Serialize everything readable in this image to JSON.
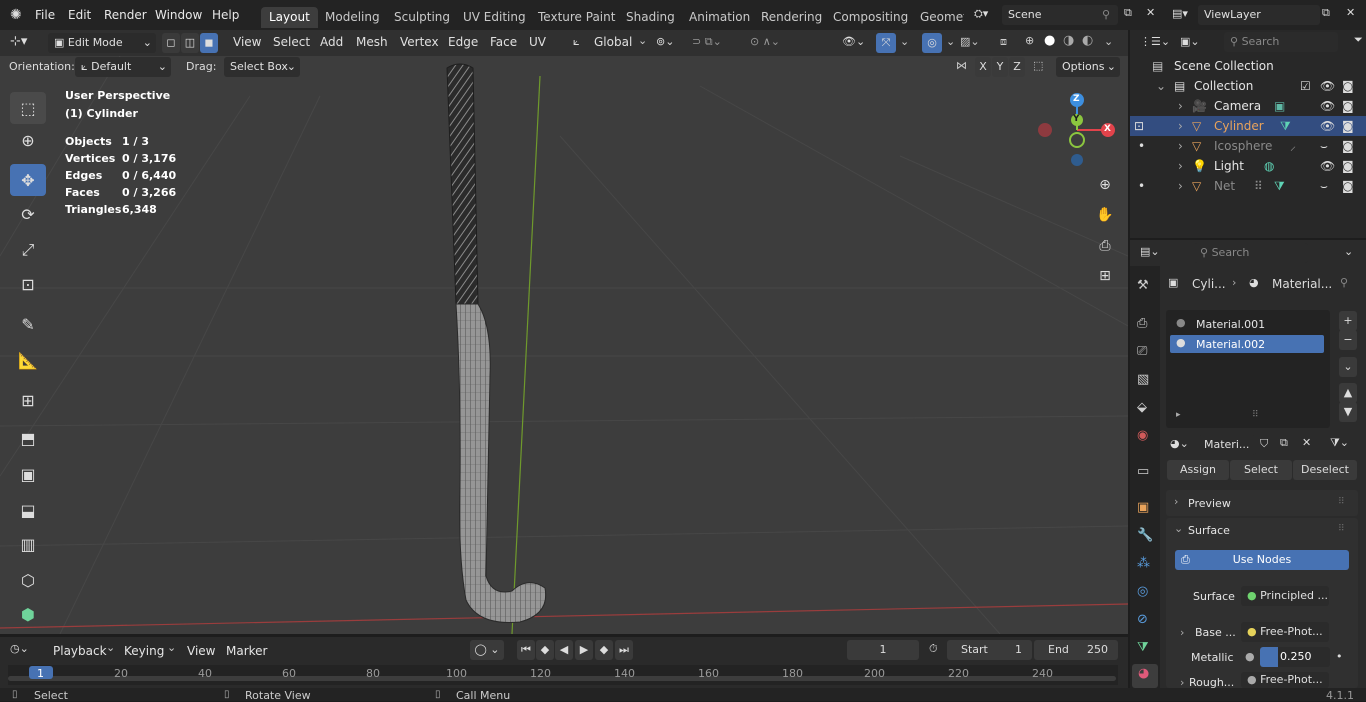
{
  "topbar": {
    "menus": [
      "File",
      "Edit",
      "Render",
      "Window",
      "Help"
    ],
    "workspaces": [
      "Layout",
      "Modeling",
      "Sculpting",
      "UV Editing",
      "Texture Paint",
      "Shading",
      "Animation",
      "Rendering",
      "Compositing",
      "Geomet"
    ],
    "active_workspace": "Layout",
    "scene": "Scene",
    "view_layer": "ViewLayer"
  },
  "viewport_header": {
    "mode": "Edit Mode",
    "menus": [
      "View",
      "Select",
      "Add",
      "Mesh",
      "Vertex",
      "Edge",
      "Face",
      "UV"
    ],
    "transform_orientation": "Global",
    "orientation_label": "Orientation:",
    "orientation_value": "Default",
    "drag_label": "Drag:",
    "drag_value": "Select Box",
    "axes": [
      "X",
      "Y",
      "Z"
    ],
    "options": "Options"
  },
  "overlay": {
    "view_name": "User Perspective",
    "object_name": "(1) Cylinder",
    "stats": [
      {
        "label": "Objects",
        "value": "1 / 3"
      },
      {
        "label": "Vertices",
        "value": "0 / 3,176"
      },
      {
        "label": "Edges",
        "value": "0 / 6,440"
      },
      {
        "label": "Faces",
        "value": "0 / 3,266"
      },
      {
        "label": "Triangles",
        "value": "6,348"
      }
    ]
  },
  "gizmo": {
    "z": "Z",
    "y": "Y",
    "x": "X"
  },
  "outliner": {
    "search_placeholder": "Search",
    "scene_collection": "Scene Collection",
    "collection": "Collection",
    "items": [
      {
        "name": "Camera",
        "color": "#e0e0e0"
      },
      {
        "name": "Cylinder",
        "color": "#e9a35b"
      },
      {
        "name": "Icosphere",
        "color": "#8a8a8a"
      },
      {
        "name": "Light",
        "color": "#c4c4c4"
      },
      {
        "name": "Net",
        "color": "#8a8a8a"
      }
    ]
  },
  "properties": {
    "search_placeholder": "Search",
    "breadcrumb_object": "Cyli...",
    "breadcrumb_material": "Material...",
    "materials": [
      "Material.001",
      "Material.002"
    ],
    "selected_material": "Material.002",
    "material_field": "Materi...",
    "assign": "Assign",
    "select": "Select",
    "deselect": "Deselect",
    "preview": "Preview",
    "surface": "Surface",
    "use_nodes": "Use Nodes",
    "surface_label": "Surface",
    "surface_value": "Principled ...",
    "base_label": "Base ...",
    "base_value": "Free-Phot...",
    "metallic_label": "Metallic",
    "metallic_value": "0.250",
    "rough_label": "Rough...",
    "rough_value": "Free-Phot..."
  },
  "timeline": {
    "menus": [
      "Playback",
      "Keying",
      "View",
      "Marker"
    ],
    "current_frame": "1",
    "start_label": "Start",
    "start": "1",
    "end_label": "End",
    "end": "250",
    "ticks": [
      "1",
      "20",
      "40",
      "60",
      "80",
      "100",
      "120",
      "140",
      "160",
      "180",
      "200",
      "220",
      "240"
    ]
  },
  "statusbar": {
    "select": "Select",
    "rotate": "Rotate View",
    "call_menu": "Call Menu",
    "version": "4.1.1"
  },
  "colors": {
    "accent": "#4772b3",
    "x_axis": "#e2434b",
    "y_axis": "#8bc53f",
    "z_axis": "#3d8fe0"
  }
}
